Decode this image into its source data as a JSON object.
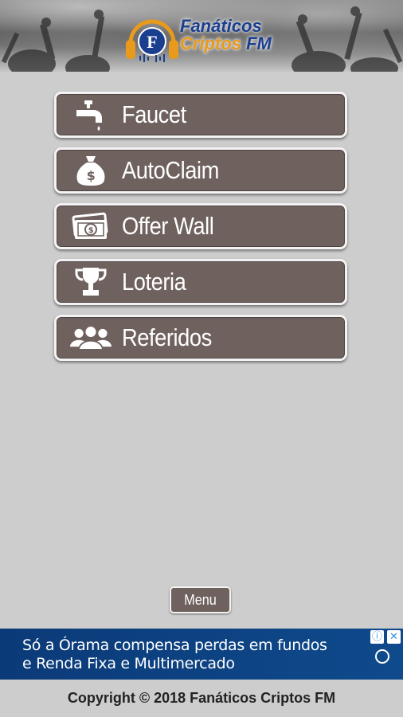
{
  "header": {
    "logo_line1": "Fanáticos",
    "logo_line2": "Criptos",
    "logo_line2_suffix": " FM",
    "logo_icon": "headphones-coin-icon"
  },
  "menu": {
    "items": [
      {
        "label": "Faucet",
        "icon": "faucet-icon"
      },
      {
        "label": "AutoClaim",
        "icon": "money-bag-icon"
      },
      {
        "label": "Offer Wall",
        "icon": "banknote-icon"
      },
      {
        "label": "Loteria",
        "icon": "trophy-icon"
      },
      {
        "label": "Referidos",
        "icon": "people-group-icon"
      }
    ],
    "menu_button_label": "Menu"
  },
  "ad": {
    "line1": "Só a Órama compensa perdas em fundos",
    "line2": "e Renda Fixa e Multimercado",
    "info_badge": "ⓘ",
    "close_badge": "✕"
  },
  "footer": {
    "copyright": "Copyright © 2018 Fanáticos Criptos FM"
  },
  "colors": {
    "button_bg": "#6f625e",
    "page_bg": "#cdcdcd",
    "ad_bg": "#0b3a78",
    "logo_blue": "#1b3f8f",
    "logo_orange": "#e99a1b"
  }
}
